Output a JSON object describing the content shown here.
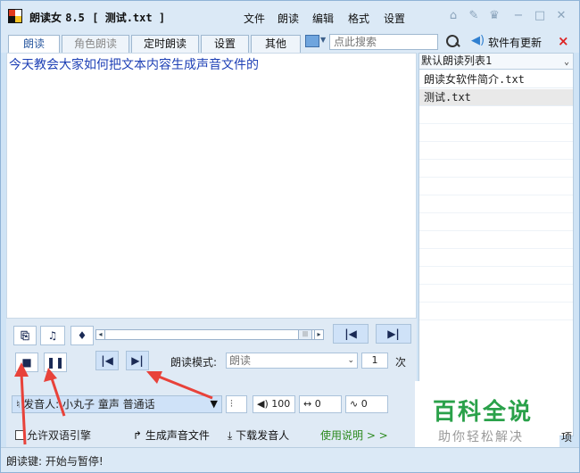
{
  "window": {
    "app_name": "朗读女",
    "version": "8.5",
    "file_bracket": "[ 测试.txt ]"
  },
  "menu": [
    "文件",
    "朗读",
    "编辑",
    "格式",
    "设置"
  ],
  "title_buttons": [
    "home-icon",
    "pin-icon",
    "skin-icon",
    "minimize-icon",
    "maximize-icon",
    "close-icon"
  ],
  "tabs": [
    {
      "label": "朗读",
      "active": true
    },
    {
      "label": "角色朗读",
      "active": false
    },
    {
      "label": "定时朗读",
      "active": false
    },
    {
      "label": "设置",
      "active": false
    },
    {
      "label": "其他",
      "active": false
    }
  ],
  "search": {
    "placeholder": "点此搜索"
  },
  "update_link": "软件有更新",
  "close_x": "×",
  "document": {
    "text": "今天教会大家如何把文本内容生成声音文件的"
  },
  "playlist": {
    "selected": "默认朗读列表1",
    "items": [
      "朗读女软件简介.txt",
      "测试.txt"
    ]
  },
  "controls": {
    "mode_label": "朗读模式:",
    "mode_value": "朗读",
    "repeat_value": "1",
    "repeat_unit": "次",
    "voice_label": "发音人:",
    "voice_value": "小丸子 童声 普通话",
    "volume": "100",
    "speed": "0",
    "pitch": "0",
    "bilingual_label": "允许双语引擎",
    "generate_audio": "生成声音文件",
    "download_voice": "下载发音人",
    "help": "使用说明 > >"
  },
  "status": {
    "text": "朗读键: 开始与暂停!"
  },
  "watermark": {
    "title": "百科全说",
    "subtitle": "助你轻松解决",
    "edge": "项"
  },
  "colors": {
    "accent": "#2c5aa0",
    "doc_text": "#1d3fb5",
    "arrow": "#e8423a",
    "watermark": "#2aa14a"
  }
}
